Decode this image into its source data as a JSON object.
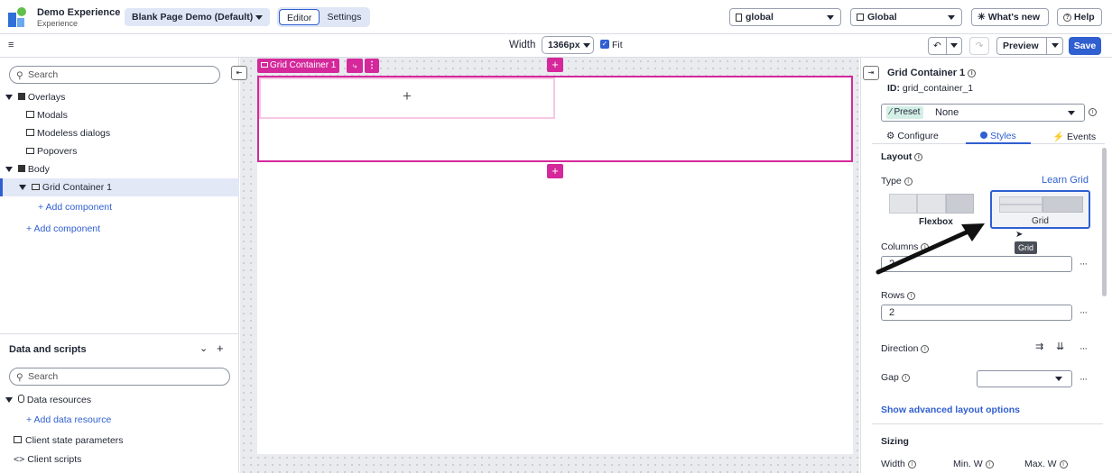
{
  "header": {
    "app_title": "Demo Experience",
    "app_subtitle": "Experience",
    "page_select": "Blank Page Demo (Default)",
    "tabs": [
      "Editor",
      "Settings"
    ],
    "scope_select": "global",
    "global_select": "Global",
    "whats_new": "What's new",
    "help": "Help"
  },
  "toolbar": {
    "width_label": "Width",
    "width_value": "1366px",
    "fit_label": "Fit",
    "fit_checked": true,
    "preview": "Preview",
    "save": "Save"
  },
  "left": {
    "search_placeholder": "Search",
    "tree": {
      "overlays": "Overlays",
      "modals": "Modals",
      "modeless": "Modeless dialogs",
      "popovers": "Popovers",
      "body": "Body",
      "grid_container": "Grid Container 1",
      "add_component_inner": "Add component",
      "add_component_outer": "Add component"
    },
    "data": {
      "title": "Data and scripts",
      "search_placeholder": "Search",
      "resources": "Data resources",
      "add_resource": "Add data resource",
      "client_state": "Client state parameters",
      "client_scripts": "Client scripts"
    }
  },
  "canvas": {
    "selected_label": "Grid Container 1"
  },
  "right": {
    "title": "Grid Container 1",
    "id_label": "ID:",
    "id_value": "grid_container_1",
    "preset_badge": "Preset",
    "preset_value": "None",
    "tabs": [
      "Configure",
      "Styles",
      "Events"
    ],
    "layout_heading": "Layout",
    "type_label": "Type",
    "learn_grid": "Learn Grid",
    "type_flexbox": "Flexbox",
    "type_grid": "Grid",
    "tooltip": "Grid",
    "columns_label": "Columns",
    "columns_value": "2",
    "rows_label": "Rows",
    "rows_value": "2",
    "direction_label": "Direction",
    "gap_label": "Gap",
    "advanced_link": "Show advanced layout options",
    "sizing_heading": "Sizing",
    "width_label": "Width",
    "min_w_label": "Min. W",
    "max_w_label": "Max. W"
  },
  "colors": {
    "accent": "#2f5fd0",
    "selection": "#d4289b",
    "panel_bg": "#ffffff"
  }
}
